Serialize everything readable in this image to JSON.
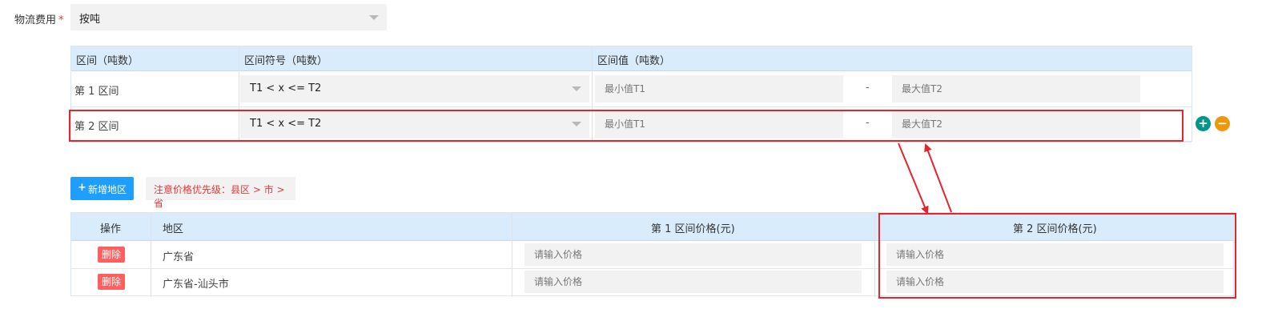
{
  "logistics_fee": {
    "label": "物流费用",
    "required_mark": "*",
    "selected": "按吨"
  },
  "interval_table": {
    "headers": [
      "区间（吨数）",
      "区间符号（吨数）",
      "区间值（吨数）"
    ],
    "rows": [
      {
        "label": "第 1 区间",
        "symbol": "T1 < x <= T2",
        "min_placeholder": "最小值T1",
        "separator": "-",
        "max_placeholder": "最大值T2"
      },
      {
        "label": "第 2 区间",
        "symbol": "T1 < x <= T2",
        "min_placeholder": "最小值T1",
        "separator": "-",
        "max_placeholder": "最大值T2"
      }
    ],
    "add_symbol": "+",
    "remove_symbol": "−"
  },
  "toolbar": {
    "add_icon": "+",
    "add_region_label": "新增地区",
    "notice": "注意价格优先级：县区 > 市 > 省"
  },
  "region_table": {
    "headers": [
      "操作",
      "地区",
      "第 1 区间价格(元)",
      "第 2 区间价格(元)"
    ],
    "rows": [
      {
        "delete_label": "删除",
        "region": "广东省",
        "price1_placeholder": "请输入价格",
        "price2_placeholder": "请输入价格"
      },
      {
        "delete_label": "删除",
        "region": "广东省-汕头市",
        "price1_placeholder": "请输入价格",
        "price2_placeholder": "请输入价格"
      }
    ]
  },
  "colors": {
    "header_bg": "#d9ecfb",
    "primary_button": "#1e9fff",
    "delete_button": "#ff5f5f",
    "add_round_button": "#009688",
    "remove_round_button": "#f0960a",
    "highlight_red": "#e8232b",
    "notice_text": "#e4393c"
  },
  "icons": {
    "add_row": "plus-circle-icon",
    "remove_row": "minus-circle-icon",
    "dropdown": "caret-down-icon",
    "add_region": "plus-icon"
  }
}
